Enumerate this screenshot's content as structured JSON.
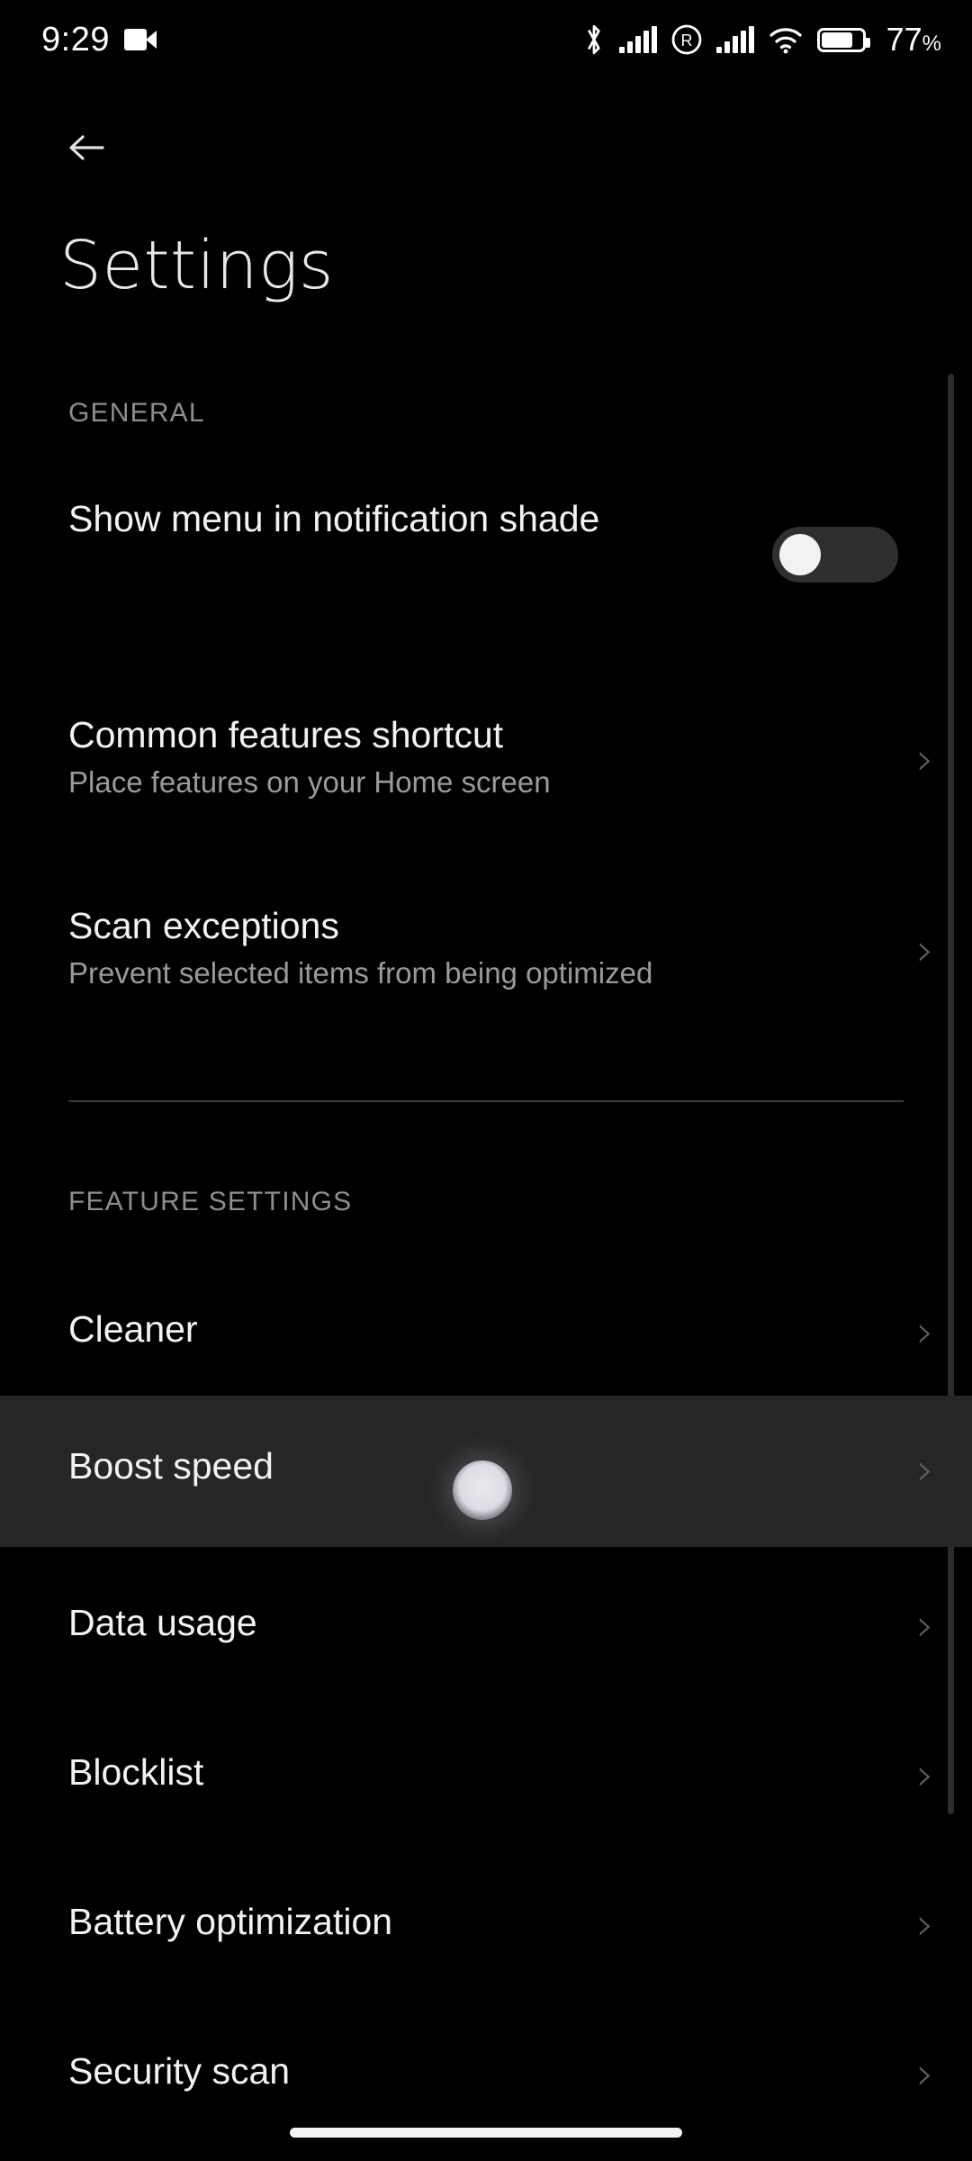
{
  "status_bar": {
    "time": "9:29",
    "battery_percent": "77",
    "battery_percent_symbol": "%",
    "icons": [
      "video-camera-icon",
      "bluetooth-icon",
      "cellular-signal-icon",
      "roaming-icon",
      "cellular-signal-2-icon",
      "wifi-icon",
      "battery-icon"
    ]
  },
  "app_bar": {
    "back_label": "back-arrow",
    "title": "Settings"
  },
  "sections": [
    {
      "header": "GENERAL",
      "items": [
        {
          "title": "Show menu in notification shade",
          "subtitle": "",
          "control": "toggle",
          "toggle_on": false
        },
        {
          "title": "Common features shortcut",
          "subtitle": "Place features on your Home screen",
          "control": "chevron"
        },
        {
          "title": "Scan exceptions",
          "subtitle": "Prevent selected items from being optimized",
          "control": "chevron"
        }
      ]
    },
    {
      "header": "FEATURE SETTINGS",
      "items": [
        {
          "title": "Cleaner",
          "subtitle": "",
          "control": "chevron",
          "pressed": false
        },
        {
          "title": "Boost speed",
          "subtitle": "",
          "control": "chevron",
          "pressed": true
        },
        {
          "title": "Data usage",
          "subtitle": "",
          "control": "chevron",
          "pressed": false
        },
        {
          "title": "Blocklist",
          "subtitle": "",
          "control": "chevron",
          "pressed": false
        },
        {
          "title": "Battery optimization",
          "subtitle": "",
          "control": "chevron",
          "pressed": false
        },
        {
          "title": "Security scan",
          "subtitle": "",
          "control": "chevron",
          "pressed": false
        }
      ]
    }
  ],
  "glyphs": {
    "chevron_right": "›"
  },
  "colors": {
    "background": "#000000",
    "row_pressed": "#262626",
    "primary_text": "#f2f2f2",
    "secondary_text": "#9a9a9a",
    "section_header": "#8e8e8e",
    "chevron": "#5d5d5d",
    "toggle_track": "#2f2f2f",
    "toggle_knob": "#f2f2f2",
    "divider": "#3a3a3a",
    "scrollbar": "#2b2b2b",
    "home_indicator": "#f2f2f2"
  }
}
